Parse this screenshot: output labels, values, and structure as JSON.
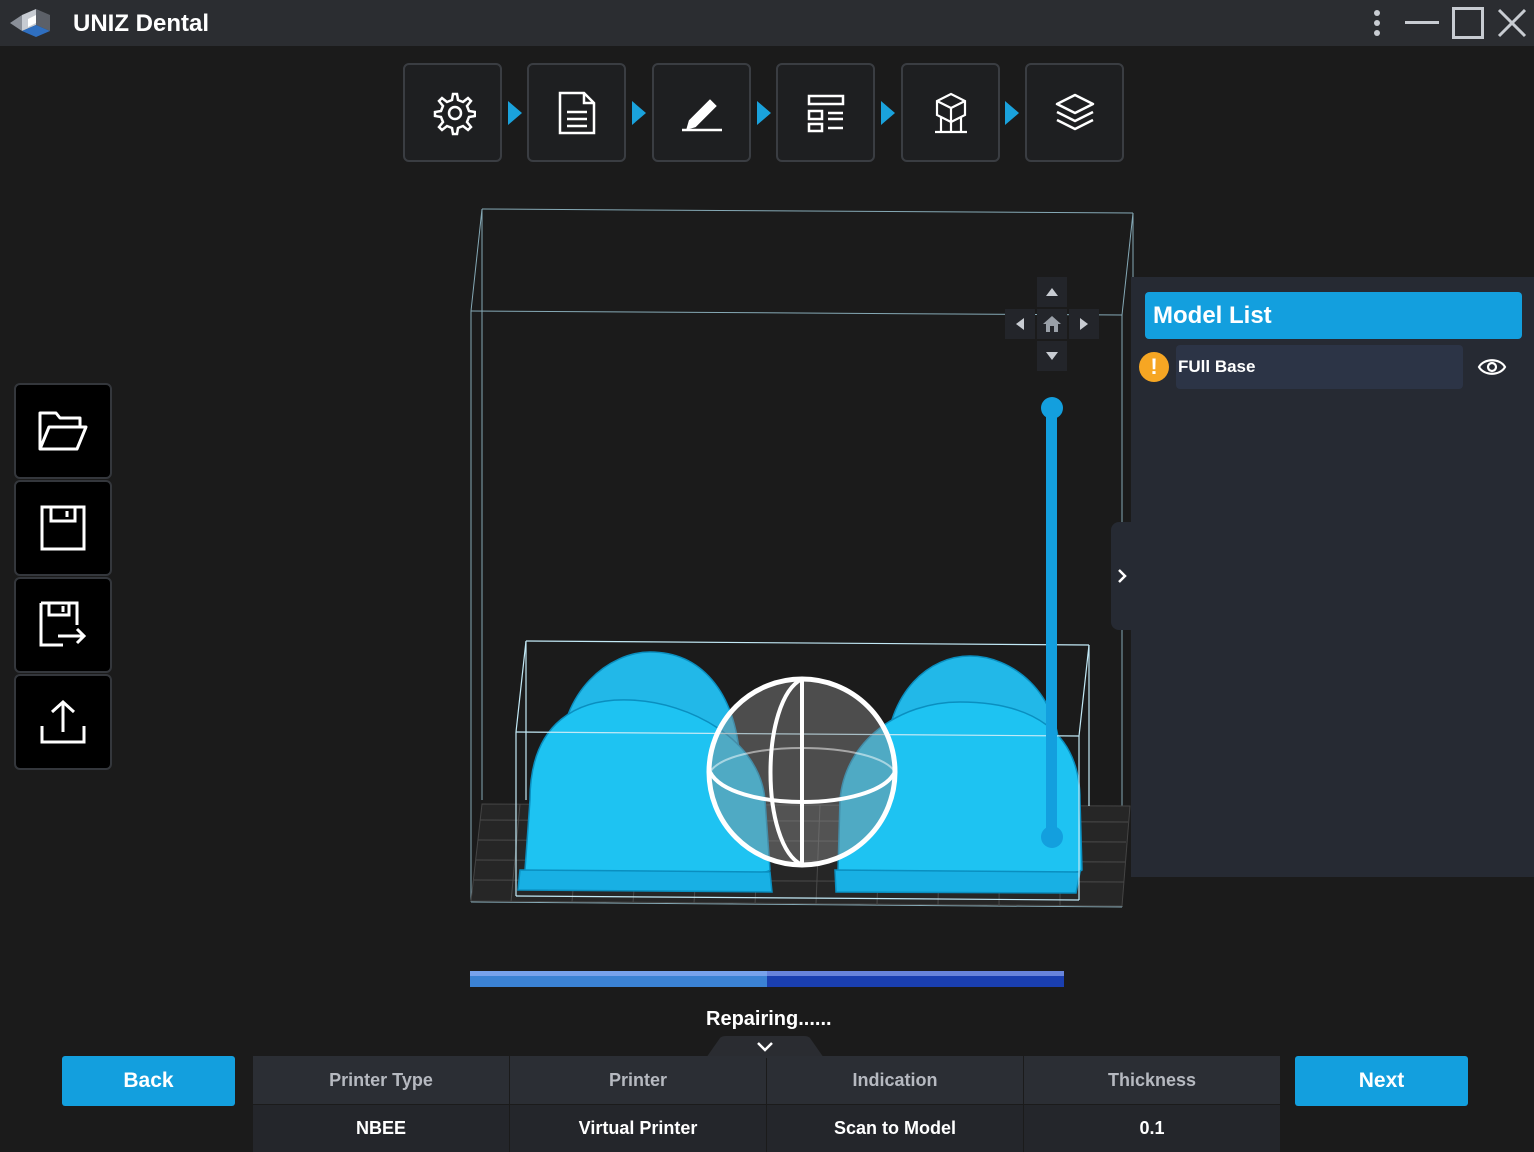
{
  "app": {
    "title": "UNIZ Dental"
  },
  "workflow": {
    "steps": [
      {
        "icon": "gear-icon"
      },
      {
        "icon": "document-icon"
      },
      {
        "icon": "pen-icon"
      },
      {
        "icon": "layout-icon"
      },
      {
        "icon": "support-icon"
      },
      {
        "icon": "layers-icon"
      }
    ]
  },
  "file_toolbar": [
    {
      "icon": "open-folder-icon"
    },
    {
      "icon": "save-icon"
    },
    {
      "icon": "save-as-icon"
    },
    {
      "icon": "export-icon"
    }
  ],
  "model_list": {
    "title": "Model List",
    "items": [
      {
        "name": "FUll Base",
        "warning": true,
        "visible": true
      }
    ]
  },
  "progress": {
    "fraction": 0.5,
    "status": "Repairing......"
  },
  "bottom": {
    "back_label": "Back",
    "next_label": "Next",
    "printer_type": {
      "label": "Printer Type",
      "value": "NBEE"
    },
    "printer": {
      "label": "Printer",
      "value": "Virtual Printer"
    },
    "indication": {
      "label": "Indication",
      "value": "Scan to Model"
    },
    "thickness": {
      "label": "Thickness",
      "value": "0.1"
    }
  },
  "colors": {
    "accent": "#139fde",
    "model": "#1ec3f2",
    "warning": "#f6a623",
    "panel": "#262a33"
  }
}
